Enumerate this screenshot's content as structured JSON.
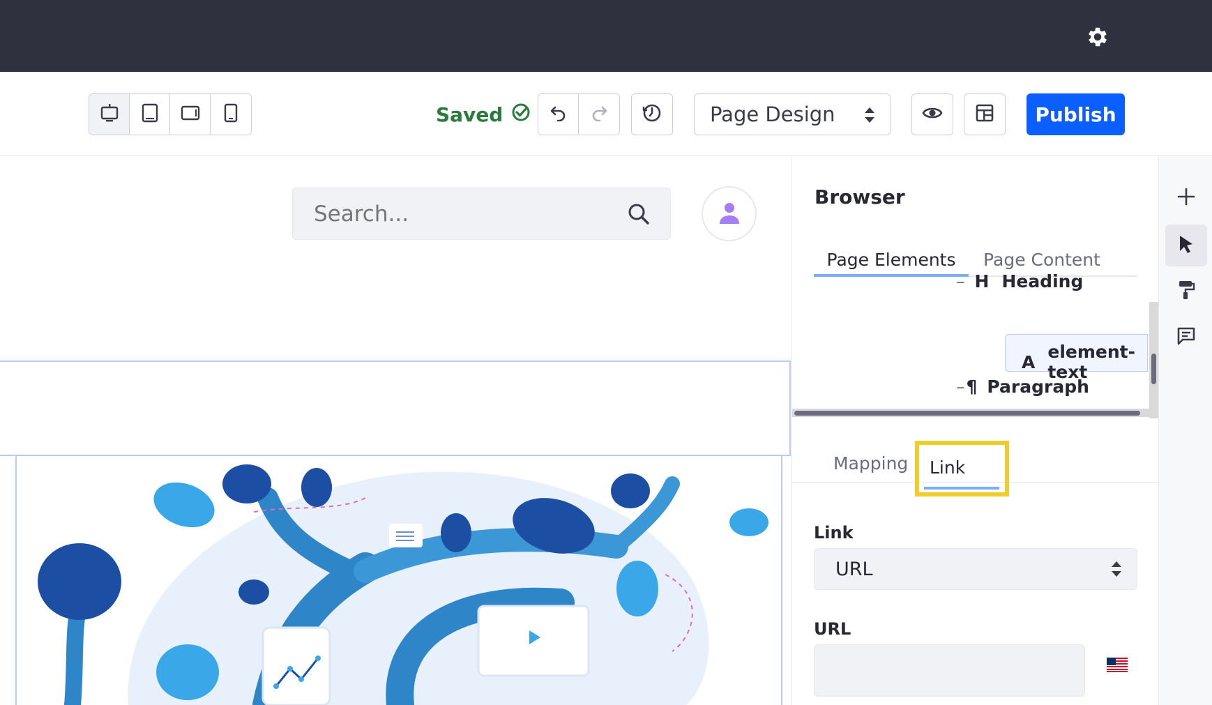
{
  "toolbar": {
    "saved_label": "Saved",
    "page_mode": "Page Design",
    "publish_label": "Publish"
  },
  "search": {
    "placeholder": "Search..."
  },
  "browser": {
    "title": "Browser",
    "tabs": [
      "Page Elements",
      "Page Content"
    ],
    "tree": [
      {
        "glyph": "H",
        "label": "Heading",
        "prefix": "–"
      },
      {
        "glyph": "A",
        "label": "element-text",
        "prefix": ""
      },
      {
        "glyph": "¶",
        "label": "Paragraph",
        "prefix": "–"
      }
    ]
  },
  "config": {
    "tabs": [
      "Mapping",
      "Link"
    ],
    "link_label": "Link",
    "link_value": "URL",
    "url_label": "URL",
    "url_value": ""
  },
  "colors": {
    "topbar": "#30313f",
    "publish": "#0b5fff",
    "saved": "#287d3c",
    "highlight": "#f1cc2b"
  },
  "icons": [
    "gear-icon",
    "desktop-icon",
    "tablet-icon",
    "tablet-landscape-icon",
    "phone-icon",
    "check-circle-icon",
    "undo-icon",
    "redo-icon",
    "history-icon",
    "eye-icon",
    "layout-icon",
    "search-icon",
    "user-icon",
    "plus-icon",
    "cursor-icon",
    "paint-roller-icon",
    "comment-icon",
    "us-flag-icon"
  ]
}
